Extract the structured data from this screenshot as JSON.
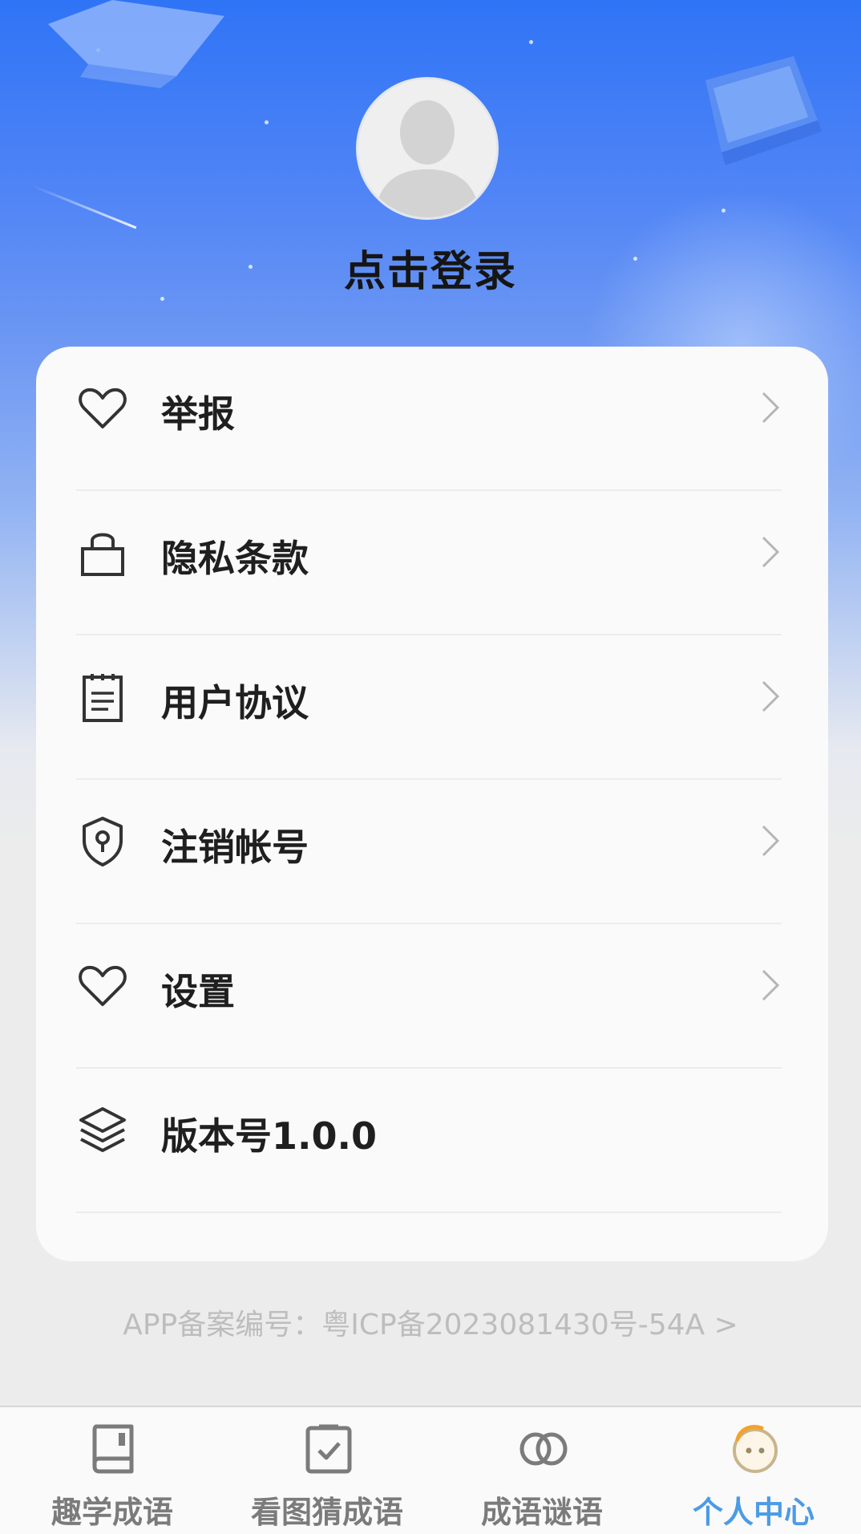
{
  "profile": {
    "login_label": "点击登录"
  },
  "menu": {
    "items": [
      {
        "label": "举报",
        "icon": "heart-icon"
      },
      {
        "label": "隐私条款",
        "icon": "lock-icon"
      },
      {
        "label": "用户协议",
        "icon": "notepad-icon"
      },
      {
        "label": "注销帐号",
        "icon": "shield-keyhole-icon"
      },
      {
        "label": "设置",
        "icon": "heart-icon"
      },
      {
        "label": "版本号1.0.0",
        "icon": "layers-icon"
      }
    ]
  },
  "footer": {
    "icp_text": "APP备案编号：粤ICP备2023081430号-54A >"
  },
  "tabbar": {
    "tabs": [
      {
        "label": "趣学成语",
        "icon": "book-icon"
      },
      {
        "label": "看图猜成语",
        "icon": "picture-check-icon"
      },
      {
        "label": "成语谜语",
        "icon": "linked-rings-icon"
      },
      {
        "label": "个人中心",
        "icon": "smiley-face-icon",
        "active": true
      }
    ]
  },
  "colors": {
    "accent": "#4c9be5",
    "hero_top": "#2f74f6",
    "background": "#ececec"
  }
}
